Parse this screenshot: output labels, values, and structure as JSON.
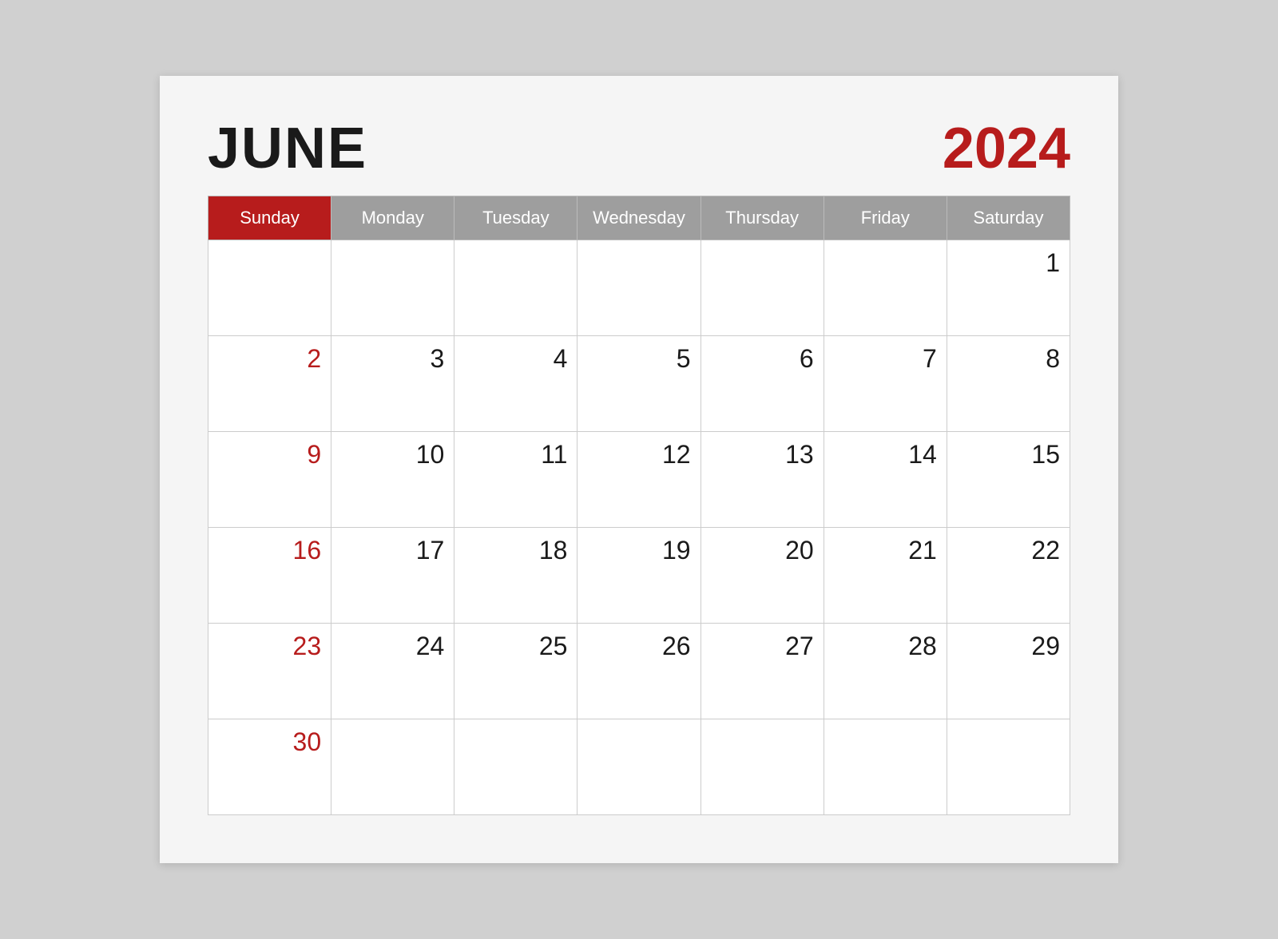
{
  "header": {
    "month": "JUNE",
    "year": "2024"
  },
  "days_of_week": [
    "Sunday",
    "Monday",
    "Tuesday",
    "Wednesday",
    "Thursday",
    "Friday",
    "Saturday"
  ],
  "weeks": [
    [
      null,
      null,
      null,
      null,
      null,
      null,
      1
    ],
    [
      2,
      3,
      4,
      5,
      6,
      7,
      8
    ],
    [
      9,
      10,
      11,
      12,
      13,
      14,
      15
    ],
    [
      16,
      17,
      18,
      19,
      20,
      21,
      22
    ],
    [
      23,
      24,
      25,
      26,
      27,
      28,
      29
    ],
    [
      30,
      null,
      null,
      null,
      null,
      null,
      null
    ]
  ],
  "sunday_indices": [
    0
  ],
  "red_days": [
    2,
    9,
    16,
    23,
    30
  ]
}
